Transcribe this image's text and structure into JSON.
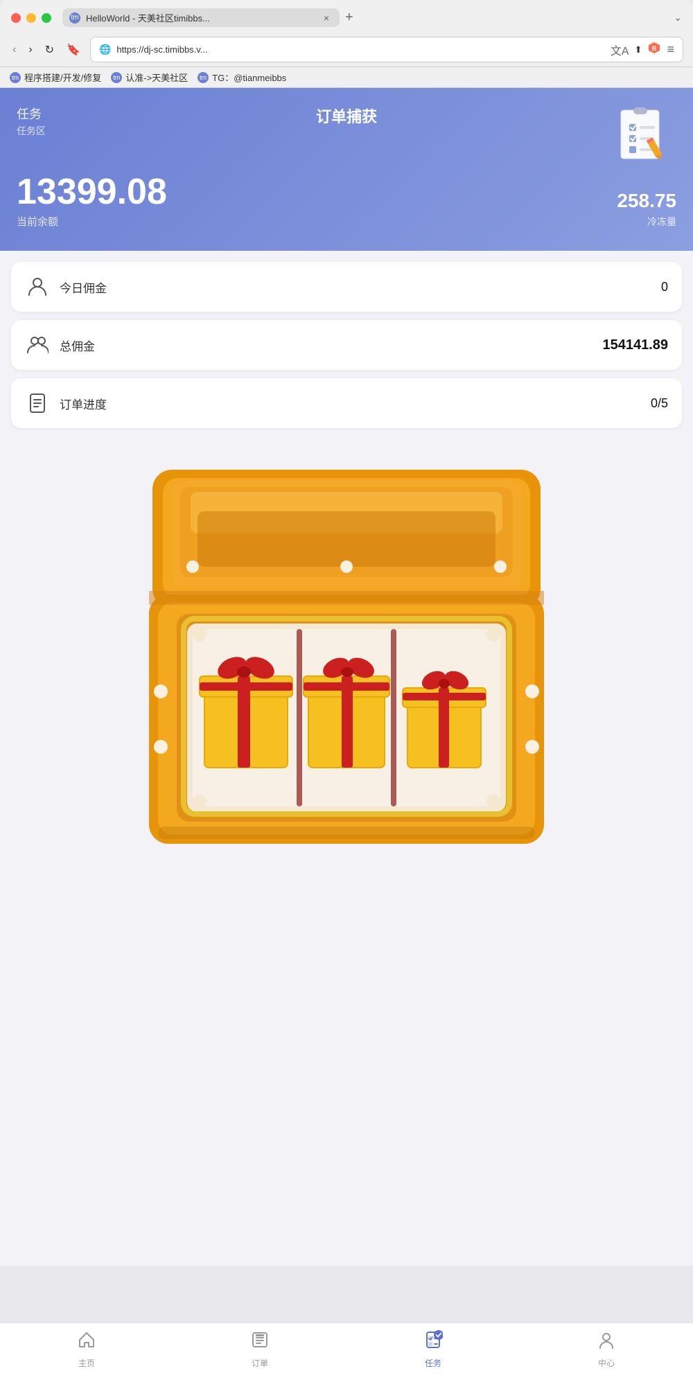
{
  "browser": {
    "tab_title": "HelloWorld - 天美社区timibbs...",
    "tab_favicon": "tm",
    "url": "https://dj-sc.timibbs.v...",
    "close_icon": "×",
    "add_tab_icon": "+",
    "chevron_icon": "⌄",
    "back_icon": "‹",
    "forward_icon": "›",
    "refresh_icon": "↻",
    "bookmark_icon": "🔖",
    "settings_icon": "⚙",
    "menu_icon": "≡",
    "translate_icon": "译",
    "share_icon": "↑",
    "brave_icon": "B"
  },
  "bookmarks": [
    {
      "label": "程序搭建/开发/修复",
      "favicon": "tm"
    },
    {
      "label": "认准->天美社区",
      "favicon": "tm"
    },
    {
      "label": "TG：@tianmeibbs",
      "favicon": "tm"
    }
  ],
  "header": {
    "task_label": "任务",
    "subtitle": "任务区",
    "title": "订单捕获",
    "balance": "13399.08",
    "balance_label": "当前余额",
    "frozen": "258.75",
    "frozen_label": "冷冻量"
  },
  "cards": [
    {
      "id": "today-commission",
      "label": "今日佣金",
      "value": "0",
      "bold": false
    },
    {
      "id": "total-commission",
      "label": "总佣金",
      "value": "154141.89",
      "bold": true
    },
    {
      "id": "order-progress",
      "label": "订单进度",
      "value": "0/5",
      "bold": false
    }
  ],
  "bottom_nav": [
    {
      "id": "home",
      "label": "主页",
      "active": false
    },
    {
      "id": "order",
      "label": "订单",
      "active": false
    },
    {
      "id": "task",
      "label": "任务",
      "active": true
    },
    {
      "id": "center",
      "label": "中心",
      "active": false
    }
  ]
}
